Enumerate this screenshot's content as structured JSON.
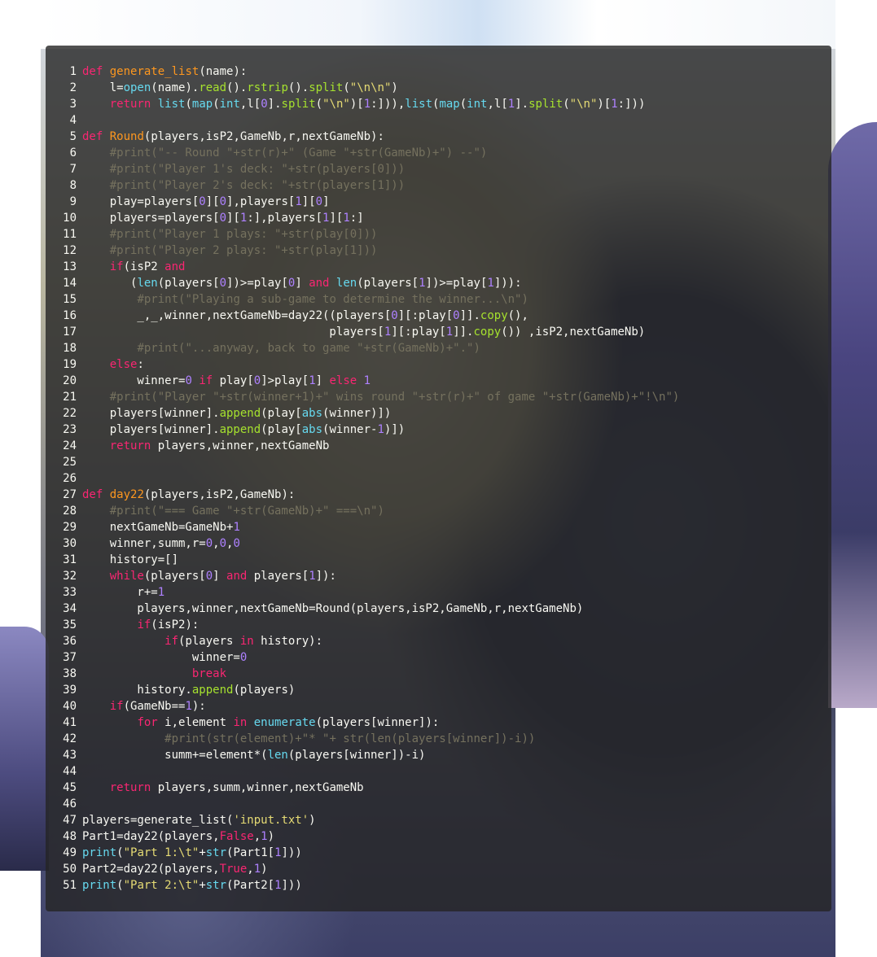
{
  "editor": {
    "lines": [
      {
        "n": "1",
        "tokens": [
          [
            "kw",
            "def"
          ],
          [
            "t",
            " "
          ],
          [
            "def",
            "generate_list"
          ],
          [
            "t",
            "(name):"
          ]
        ]
      },
      {
        "n": "2",
        "tokens": [
          [
            "t",
            "    l="
          ],
          [
            "bi",
            "open"
          ],
          [
            "t",
            "(name)."
          ],
          [
            "fn",
            "read"
          ],
          [
            "t",
            "()."
          ],
          [
            "fn",
            "rstrip"
          ],
          [
            "t",
            "()."
          ],
          [
            "fn",
            "split"
          ],
          [
            "t",
            "("
          ],
          [
            "str",
            "\"\\n\\n\""
          ],
          [
            "t",
            ")"
          ]
        ]
      },
      {
        "n": "3",
        "tokens": [
          [
            "t",
            "    "
          ],
          [
            "kw",
            "return"
          ],
          [
            "t",
            " "
          ],
          [
            "bi",
            "list"
          ],
          [
            "t",
            "("
          ],
          [
            "bi",
            "map"
          ],
          [
            "t",
            "("
          ],
          [
            "bi",
            "int"
          ],
          [
            "t",
            ",l["
          ],
          [
            "num",
            "0"
          ],
          [
            "t",
            "]."
          ],
          [
            "fn",
            "split"
          ],
          [
            "t",
            "("
          ],
          [
            "str",
            "\"\\n\""
          ],
          [
            "t",
            ")["
          ],
          [
            "num",
            "1"
          ],
          [
            "t",
            ":])),"
          ],
          [
            "bi",
            "list"
          ],
          [
            "t",
            "("
          ],
          [
            "bi",
            "map"
          ],
          [
            "t",
            "("
          ],
          [
            "bi",
            "int"
          ],
          [
            "t",
            ",l["
          ],
          [
            "num",
            "1"
          ],
          [
            "t",
            "]."
          ],
          [
            "fn",
            "split"
          ],
          [
            "t",
            "("
          ],
          [
            "str",
            "\"\\n\""
          ],
          [
            "t",
            ")["
          ],
          [
            "num",
            "1"
          ],
          [
            "t",
            ":]))"
          ]
        ]
      },
      {
        "n": "4",
        "tokens": []
      },
      {
        "n": "5",
        "tokens": [
          [
            "kw",
            "def"
          ],
          [
            "t",
            " "
          ],
          [
            "def",
            "Round"
          ],
          [
            "t",
            "(players,isP2,GameNb,r,nextGameNb):"
          ]
        ]
      },
      {
        "n": "6",
        "tokens": [
          [
            "t",
            "    "
          ],
          [
            "cm",
            "#print(\"-- Round \"+str(r)+\" (Game \"+str(GameNb)+\") --\")"
          ]
        ]
      },
      {
        "n": "7",
        "tokens": [
          [
            "t",
            "    "
          ],
          [
            "cm",
            "#print(\"Player 1's deck: \"+str(players[0]))"
          ]
        ]
      },
      {
        "n": "8",
        "tokens": [
          [
            "t",
            "    "
          ],
          [
            "cm",
            "#print(\"Player 2's deck: \"+str(players[1]))"
          ]
        ]
      },
      {
        "n": "9",
        "tokens": [
          [
            "t",
            "    play=players["
          ],
          [
            "num",
            "0"
          ],
          [
            "t",
            "]["
          ],
          [
            "num",
            "0"
          ],
          [
            "t",
            "],players["
          ],
          [
            "num",
            "1"
          ],
          [
            "t",
            "]["
          ],
          [
            "num",
            "0"
          ],
          [
            "t",
            "]"
          ]
        ]
      },
      {
        "n": "10",
        "tokens": [
          [
            "t",
            "    players=players["
          ],
          [
            "num",
            "0"
          ],
          [
            "t",
            "]["
          ],
          [
            "num",
            "1"
          ],
          [
            "t",
            ":],players["
          ],
          [
            "num",
            "1"
          ],
          [
            "t",
            "]["
          ],
          [
            "num",
            "1"
          ],
          [
            "t",
            ":]"
          ]
        ]
      },
      {
        "n": "11",
        "tokens": [
          [
            "t",
            "    "
          ],
          [
            "cm",
            "#print(\"Player 1 plays: \"+str(play[0]))"
          ]
        ]
      },
      {
        "n": "12",
        "tokens": [
          [
            "t",
            "    "
          ],
          [
            "cm",
            "#print(\"Player 2 plays: \"+str(play[1]))"
          ]
        ]
      },
      {
        "n": "13",
        "tokens": [
          [
            "t",
            "    "
          ],
          [
            "kw",
            "if"
          ],
          [
            "t",
            "(isP2 "
          ],
          [
            "kw",
            "and"
          ]
        ]
      },
      {
        "n": "14",
        "tokens": [
          [
            "t",
            "       ("
          ],
          [
            "bi",
            "len"
          ],
          [
            "t",
            "(players["
          ],
          [
            "num",
            "0"
          ],
          [
            "t",
            "])>=play["
          ],
          [
            "num",
            "0"
          ],
          [
            "t",
            "] "
          ],
          [
            "kw",
            "and"
          ],
          [
            "t",
            " "
          ],
          [
            "bi",
            "len"
          ],
          [
            "t",
            "(players["
          ],
          [
            "num",
            "1"
          ],
          [
            "t",
            "])>=play["
          ],
          [
            "num",
            "1"
          ],
          [
            "t",
            "])):"
          ]
        ]
      },
      {
        "n": "15",
        "tokens": [
          [
            "t",
            "        "
          ],
          [
            "cm",
            "#print(\"Playing a sub-game to determine the winner...\\n\")"
          ]
        ]
      },
      {
        "n": "16",
        "tokens": [
          [
            "t",
            "        _,_,winner,nextGameNb=day22((players["
          ],
          [
            "num",
            "0"
          ],
          [
            "t",
            "][:play["
          ],
          [
            "num",
            "0"
          ],
          [
            "t",
            "]]."
          ],
          [
            "fn",
            "copy"
          ],
          [
            "t",
            "(),"
          ]
        ]
      },
      {
        "n": "17",
        "tokens": [
          [
            "t",
            "                                    players["
          ],
          [
            "num",
            "1"
          ],
          [
            "t",
            "][:play["
          ],
          [
            "num",
            "1"
          ],
          [
            "t",
            "]]."
          ],
          [
            "fn",
            "copy"
          ],
          [
            "t",
            "()) ,isP2,nextGameNb)"
          ]
        ]
      },
      {
        "n": "18",
        "tokens": [
          [
            "t",
            "        "
          ],
          [
            "cm",
            "#print(\"...anyway, back to game \"+str(GameNb)+\".\")"
          ]
        ]
      },
      {
        "n": "19",
        "tokens": [
          [
            "t",
            "    "
          ],
          [
            "kw",
            "else"
          ],
          [
            "t",
            ":"
          ]
        ]
      },
      {
        "n": "20",
        "tokens": [
          [
            "t",
            "        winner="
          ],
          [
            "num",
            "0"
          ],
          [
            "t",
            " "
          ],
          [
            "kw",
            "if"
          ],
          [
            "t",
            " play["
          ],
          [
            "num",
            "0"
          ],
          [
            "t",
            "]>play["
          ],
          [
            "num",
            "1"
          ],
          [
            "t",
            "] "
          ],
          [
            "kw",
            "else"
          ],
          [
            "t",
            " "
          ],
          [
            "num",
            "1"
          ]
        ]
      },
      {
        "n": "21",
        "tokens": [
          [
            "t",
            "    "
          ],
          [
            "cm",
            "#print(\"Player \"+str(winner+1)+\" wins round \"+str(r)+\" of game \"+str(GameNb)+\"!\\n\")"
          ]
        ]
      },
      {
        "n": "22",
        "tokens": [
          [
            "t",
            "    players[winner]."
          ],
          [
            "fn",
            "append"
          ],
          [
            "t",
            "(play["
          ],
          [
            "bi",
            "abs"
          ],
          [
            "t",
            "(winner)])"
          ]
        ]
      },
      {
        "n": "23",
        "tokens": [
          [
            "t",
            "    players[winner]."
          ],
          [
            "fn",
            "append"
          ],
          [
            "t",
            "(play["
          ],
          [
            "bi",
            "abs"
          ],
          [
            "t",
            "(winner-"
          ],
          [
            "num",
            "1"
          ],
          [
            "t",
            ")])"
          ]
        ]
      },
      {
        "n": "24",
        "tokens": [
          [
            "t",
            "    "
          ],
          [
            "kw",
            "return"
          ],
          [
            "t",
            " players,winner,nextGameNb"
          ]
        ]
      },
      {
        "n": "25",
        "tokens": []
      },
      {
        "n": "26",
        "tokens": []
      },
      {
        "n": "27",
        "tokens": [
          [
            "kw",
            "def"
          ],
          [
            "t",
            " "
          ],
          [
            "def",
            "day22"
          ],
          [
            "t",
            "(players,isP2,GameNb):"
          ]
        ]
      },
      {
        "n": "28",
        "tokens": [
          [
            "t",
            "    "
          ],
          [
            "cm",
            "#print(\"=== Game \"+str(GameNb)+\" ===\\n\")"
          ]
        ]
      },
      {
        "n": "29",
        "tokens": [
          [
            "t",
            "    nextGameNb=GameNb+"
          ],
          [
            "num",
            "1"
          ]
        ]
      },
      {
        "n": "30",
        "tokens": [
          [
            "t",
            "    winner,summ,r="
          ],
          [
            "num",
            "0"
          ],
          [
            "t",
            ","
          ],
          [
            "num",
            "0"
          ],
          [
            "t",
            ","
          ],
          [
            "num",
            "0"
          ]
        ]
      },
      {
        "n": "31",
        "tokens": [
          [
            "t",
            "    history=[]"
          ]
        ]
      },
      {
        "n": "32",
        "tokens": [
          [
            "t",
            "    "
          ],
          [
            "kw",
            "while"
          ],
          [
            "t",
            "(players["
          ],
          [
            "num",
            "0"
          ],
          [
            "t",
            "] "
          ],
          [
            "kw",
            "and"
          ],
          [
            "t",
            " players["
          ],
          [
            "num",
            "1"
          ],
          [
            "t",
            "]):"
          ]
        ]
      },
      {
        "n": "33",
        "tokens": [
          [
            "t",
            "        r+="
          ],
          [
            "num",
            "1"
          ]
        ]
      },
      {
        "n": "34",
        "tokens": [
          [
            "t",
            "        players,winner,nextGameNb=Round(players,isP2,GameNb,r,nextGameNb)"
          ]
        ]
      },
      {
        "n": "35",
        "tokens": [
          [
            "t",
            "        "
          ],
          [
            "kw",
            "if"
          ],
          [
            "t",
            "(isP2):"
          ]
        ]
      },
      {
        "n": "36",
        "tokens": [
          [
            "t",
            "            "
          ],
          [
            "kw",
            "if"
          ],
          [
            "t",
            "(players "
          ],
          [
            "kw",
            "in"
          ],
          [
            "t",
            " history):"
          ]
        ]
      },
      {
        "n": "37",
        "tokens": [
          [
            "t",
            "                winner="
          ],
          [
            "num",
            "0"
          ]
        ]
      },
      {
        "n": "38",
        "tokens": [
          [
            "t",
            "                "
          ],
          [
            "kw",
            "break"
          ]
        ]
      },
      {
        "n": "39",
        "tokens": [
          [
            "t",
            "        history."
          ],
          [
            "fn",
            "append"
          ],
          [
            "t",
            "(players)"
          ]
        ]
      },
      {
        "n": "40",
        "tokens": [
          [
            "t",
            "    "
          ],
          [
            "kw",
            "if"
          ],
          [
            "t",
            "(GameNb=="
          ],
          [
            "num",
            "1"
          ],
          [
            "t",
            "):"
          ]
        ]
      },
      {
        "n": "41",
        "tokens": [
          [
            "t",
            "        "
          ],
          [
            "kw",
            "for"
          ],
          [
            "t",
            " i,element "
          ],
          [
            "kw",
            "in"
          ],
          [
            "t",
            " "
          ],
          [
            "bi",
            "enumerate"
          ],
          [
            "t",
            "(players[winner]):"
          ]
        ]
      },
      {
        "n": "42",
        "tokens": [
          [
            "t",
            "            "
          ],
          [
            "cm",
            "#print(str(element)+\"* \"+ str(len(players[winner])-i))"
          ]
        ]
      },
      {
        "n": "43",
        "tokens": [
          [
            "t",
            "            summ+=element*("
          ],
          [
            "bi",
            "len"
          ],
          [
            "t",
            "(players[winner])-i)"
          ]
        ]
      },
      {
        "n": "44",
        "tokens": []
      },
      {
        "n": "45",
        "tokens": [
          [
            "t",
            "    "
          ],
          [
            "kw",
            "return"
          ],
          [
            "t",
            " players,summ,winner,nextGameNb"
          ]
        ]
      },
      {
        "n": "46",
        "tokens": []
      },
      {
        "n": "47",
        "tokens": [
          [
            "t",
            "players=generate_list("
          ],
          [
            "str",
            "'input.txt'"
          ],
          [
            "t",
            ")"
          ]
        ]
      },
      {
        "n": "48",
        "tokens": [
          [
            "t",
            "Part1=day22(players,"
          ],
          [
            "bool",
            "False"
          ],
          [
            "t",
            ","
          ],
          [
            "num",
            "1"
          ],
          [
            "t",
            ")"
          ]
        ]
      },
      {
        "n": "49",
        "tokens": [
          [
            "bi",
            "print"
          ],
          [
            "t",
            "("
          ],
          [
            "str",
            "\"Part 1:\\t\""
          ],
          [
            "t",
            "+"
          ],
          [
            "bi",
            "str"
          ],
          [
            "t",
            "(Part1["
          ],
          [
            "num",
            "1"
          ],
          [
            "t",
            "]))"
          ]
        ]
      },
      {
        "n": "50",
        "tokens": [
          [
            "t",
            "Part2=day22(players,"
          ],
          [
            "bool",
            "True"
          ],
          [
            "t",
            ","
          ],
          [
            "num",
            "1"
          ],
          [
            "t",
            ")"
          ]
        ]
      },
      {
        "n": "51",
        "tokens": [
          [
            "bi",
            "print"
          ],
          [
            "t",
            "("
          ],
          [
            "str",
            "\"Part 2:\\t\""
          ],
          [
            "t",
            "+"
          ],
          [
            "bi",
            "str"
          ],
          [
            "t",
            "(Part2["
          ],
          [
            "num",
            "1"
          ],
          [
            "t",
            "]))"
          ]
        ]
      }
    ]
  }
}
